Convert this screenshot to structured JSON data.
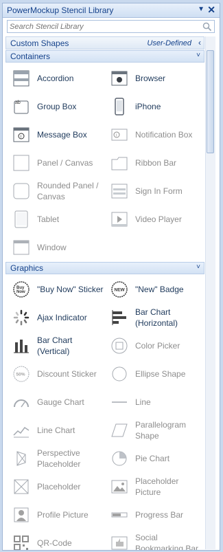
{
  "panel": {
    "title": "PowerMockup Stencil Library",
    "dropdown_glyph": "▼",
    "close_glyph": "✕"
  },
  "search": {
    "placeholder": "Search Stencil Library"
  },
  "custom_shapes": {
    "label": "Custom Shapes",
    "tag": "User-Defined",
    "chevron": "‹"
  },
  "sections": {
    "containers": {
      "label": "Containers",
      "chevron": "˅"
    },
    "graphics": {
      "label": "Graphics",
      "chevron": "˅"
    }
  },
  "containers": [
    {
      "label": "Accordion",
      "icon": "accordion-icon",
      "enabled": true
    },
    {
      "label": "Browser",
      "icon": "browser-icon",
      "enabled": true
    },
    {
      "label": "Group Box",
      "icon": "group-box-icon",
      "enabled": true
    },
    {
      "label": "iPhone",
      "icon": "iphone-icon",
      "enabled": true
    },
    {
      "label": "Message Box",
      "icon": "message-box-icon",
      "enabled": true
    },
    {
      "label": "Notification Box",
      "icon": "notification-box-icon",
      "enabled": false
    },
    {
      "label": "Panel / Canvas",
      "icon": "panel-icon",
      "enabled": false
    },
    {
      "label": "Ribbon Bar",
      "icon": "ribbon-bar-icon",
      "enabled": false
    },
    {
      "label": "Rounded Panel / Canvas",
      "icon": "rounded-panel-icon",
      "enabled": false
    },
    {
      "label": "Sign In Form",
      "icon": "sign-in-form-icon",
      "enabled": false
    },
    {
      "label": "Tablet",
      "icon": "tablet-icon",
      "enabled": false
    },
    {
      "label": "Video Player",
      "icon": "video-player-icon",
      "enabled": false
    },
    {
      "label": "Window",
      "icon": "window-icon",
      "enabled": false
    }
  ],
  "graphics": [
    {
      "label": "\"Buy Now\" Sticker",
      "icon": "buy-now-sticker-icon",
      "enabled": true
    },
    {
      "label": "\"New\" Badge",
      "icon": "new-badge-icon",
      "enabled": true
    },
    {
      "label": "Ajax Indicator",
      "icon": "ajax-indicator-icon",
      "enabled": true
    },
    {
      "label": "Bar Chart (Horizontal)",
      "icon": "bar-chart-horizontal-icon",
      "enabled": true
    },
    {
      "label": "Bar Chart (Vertical)",
      "icon": "bar-chart-vertical-icon",
      "enabled": true
    },
    {
      "label": "Color Picker",
      "icon": "color-picker-icon",
      "enabled": false
    },
    {
      "label": "Discount Sticker",
      "icon": "discount-sticker-icon",
      "enabled": false
    },
    {
      "label": "Ellipse Shape",
      "icon": "ellipse-icon",
      "enabled": false
    },
    {
      "label": "Gauge Chart",
      "icon": "gauge-chart-icon",
      "enabled": false
    },
    {
      "label": "Line",
      "icon": "line-icon",
      "enabled": false
    },
    {
      "label": "Line Chart",
      "icon": "line-chart-icon",
      "enabled": false
    },
    {
      "label": "Parallelogram Shape",
      "icon": "parallelogram-icon",
      "enabled": false
    },
    {
      "label": "Perspective Placeholder",
      "icon": "perspective-placeholder-icon",
      "enabled": false
    },
    {
      "label": "Pie Chart",
      "icon": "pie-chart-icon",
      "enabled": false
    },
    {
      "label": "Placeholder",
      "icon": "placeholder-icon",
      "enabled": false
    },
    {
      "label": "Placeholder Picture",
      "icon": "placeholder-picture-icon",
      "enabled": false
    },
    {
      "label": "Profile Picture",
      "icon": "profile-picture-icon",
      "enabled": false
    },
    {
      "label": "Progress Bar",
      "icon": "progress-bar-icon",
      "enabled": false
    },
    {
      "label": "QR-Code",
      "icon": "qr-code-icon",
      "enabled": false
    },
    {
      "label": "Social Bookmarking Bar",
      "icon": "social-bookmarking-icon",
      "enabled": false
    }
  ]
}
